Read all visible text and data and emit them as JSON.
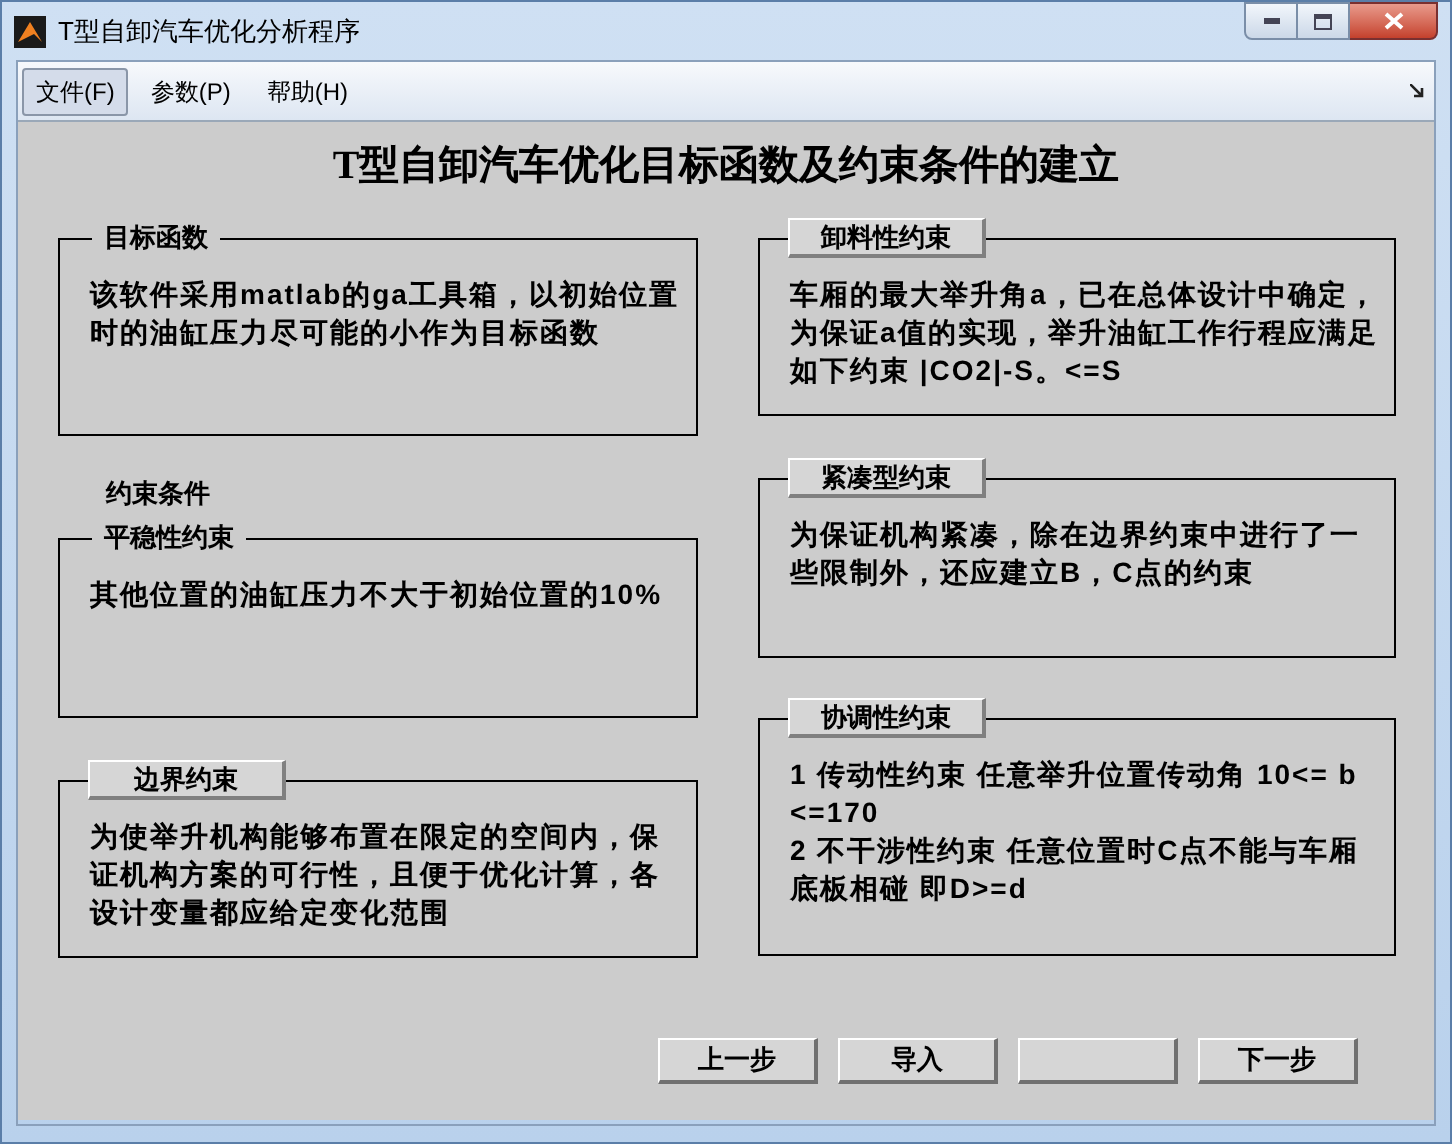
{
  "window": {
    "title": "T型自卸汽车优化分析程序"
  },
  "menu": [
    {
      "label": "文件(F)",
      "selected": true
    },
    {
      "label": "参数(P)",
      "selected": false
    },
    {
      "label": "帮助(H)",
      "selected": false
    }
  ],
  "heading": "T型自卸汽车优化目标函数及约束条件的建立",
  "left_column": [
    {
      "kind": "panel",
      "title": "目标函数",
      "title_raised": false,
      "paragraphs": [
        "该软件采用matlab的ga工具箱，以初始位置时的油缸压力尽可能的小作为目标函数"
      ]
    },
    {
      "kind": "label",
      "text": "约束条件"
    },
    {
      "kind": "panel",
      "title": "平稳性约束",
      "title_raised": false,
      "paragraphs": [
        "其他位置的油缸压力不大于初始位置的10%"
      ]
    },
    {
      "kind": "panel",
      "title": "边界约束",
      "title_raised": true,
      "paragraphs": [
        "为使举升机构能够布置在限定的空间内，保证机构方案的可行性，且便于优化计算，各设计变量都应给定变化范围"
      ]
    }
  ],
  "right_column": [
    {
      "kind": "panel",
      "title": "卸料性约束",
      "title_raised": true,
      "paragraphs": [
        "车厢的最大举升角a，已在总体设计中确定，为保证a值的实现，举升油缸工作行程应满足如下约束  |CO2|-S。<=S"
      ]
    },
    {
      "kind": "panel",
      "title": "紧凑型约束",
      "title_raised": true,
      "paragraphs": [
        "为保证机构紧凑，除在边界约束中进行了一些限制外，还应建立B，C点的约束"
      ]
    },
    {
      "kind": "panel",
      "title": "协调性约束",
      "title_raised": true,
      "paragraphs": [
        "1  传动性约束 任意举升位置传动角 10<=  b  <=170",
        "2  不干涉性约束 任意位置时C点不能与车厢底板相碰 即D>=d"
      ]
    }
  ],
  "buttons": [
    {
      "kind": "labelled",
      "label": "上一步"
    },
    {
      "kind": "labelled",
      "label": "导入"
    },
    {
      "kind": "blank"
    },
    {
      "kind": "labelled",
      "label": "下一步"
    }
  ]
}
